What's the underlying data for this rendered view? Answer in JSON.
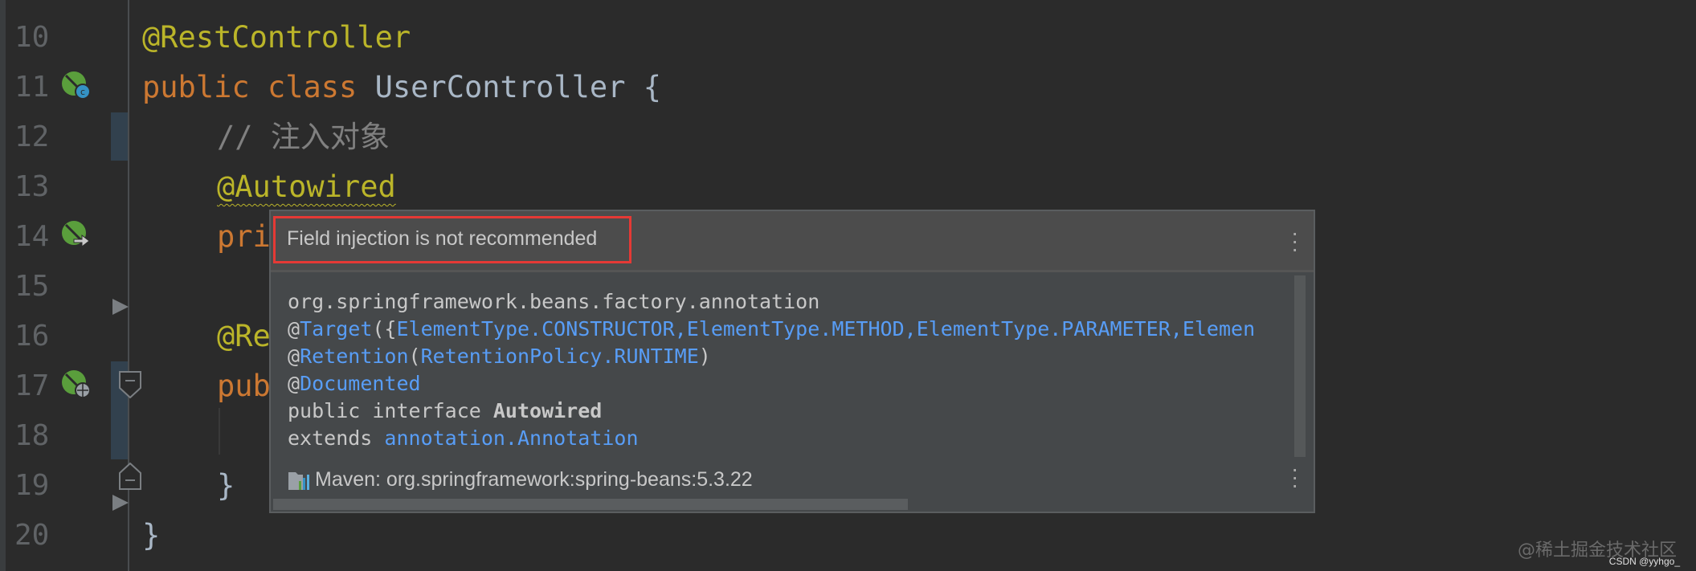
{
  "editor": {
    "line_numbers": [
      "10",
      "11",
      "12",
      "13",
      "14",
      "15",
      "16",
      "17",
      "18",
      "19",
      "20"
    ],
    "lines": {
      "l10": "@RestController",
      "l11_kw1": "public",
      "l11_kw2": "class",
      "l11_name": "UserController {",
      "l12": "// 注入对象",
      "l13": "@Autowired",
      "l14": "pri",
      "l16": "@Re",
      "l17": "pub",
      "l19": "}",
      "l20": "}"
    },
    "gutter_icons": [
      "spring-bean-class-icon",
      "spring-bean-injection-icon",
      "spring-web-endpoint-icon"
    ]
  },
  "popup": {
    "title": "Field injection is not recommended",
    "doc": {
      "package": "org.springframework.beans.factory.annotation",
      "target_at": "@",
      "target": "Target",
      "target_open": "({",
      "target_args": "ElementType.CONSTRUCTOR,ElementType.METHOD,ElementType.PARAMETER,Elemen",
      "retention_at": "@",
      "retention": "Retention",
      "retention_open": "(",
      "retention_arg": "RetentionPolicy.RUNTIME",
      "retention_close": ")",
      "documented_at": "@",
      "documented": "Documented",
      "decl_prefix": "public interface ",
      "decl_name": "Autowired",
      "extends_kw": "extends ",
      "extends_type": "annotation.Annotation"
    },
    "library": "Maven: org.springframework:spring-beans:5.3.22"
  },
  "watermark": {
    "juejin": "@稀土掘金技术社区",
    "csdn": "CSDN @yyhgo_"
  },
  "colors": {
    "background": "#2b2b2b",
    "annotation": "#bbb529",
    "keyword": "#cc7832",
    "link": "#589df6",
    "highlight_box": "#e53935"
  }
}
